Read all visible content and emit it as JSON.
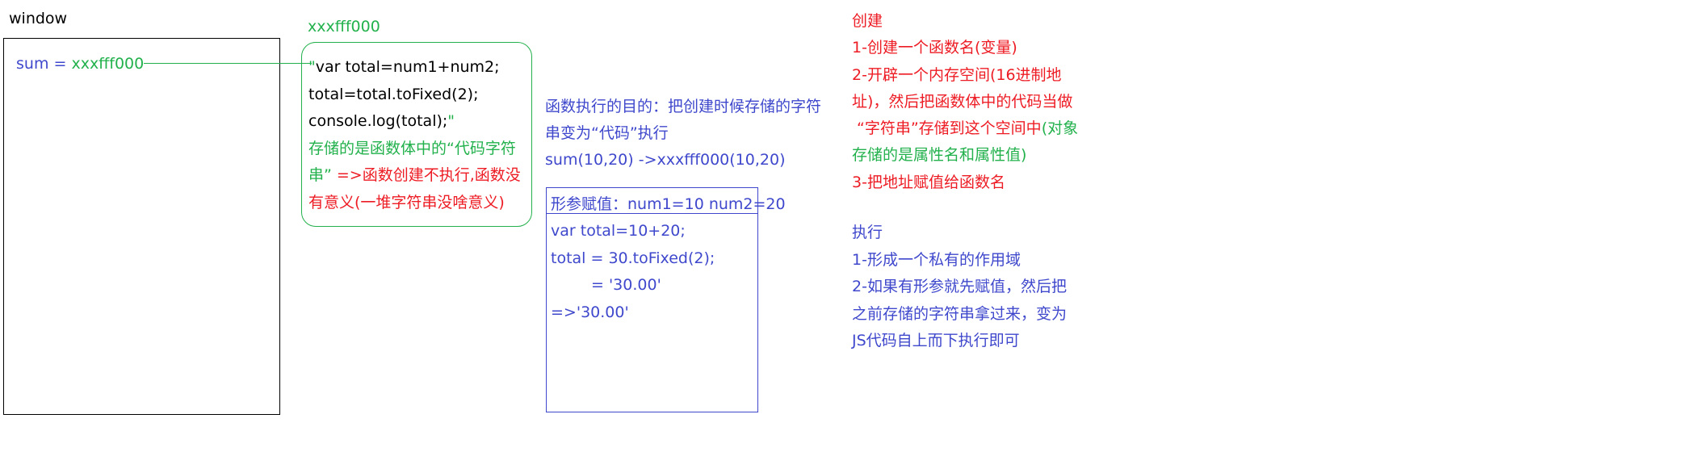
{
  "window": {
    "title": "window",
    "var_name": "sum",
    "equals": " = ",
    "address": "xxxfff000"
  },
  "heap": {
    "address": "xxxfff000",
    "code_line1_quote": "\"",
    "code_line1": "var total=num1+num2;",
    "code_line2": "total=total.toFixed(2);",
    "code_line3": "console.log(total);",
    "code_line3_quote": "\"",
    "note_line1": "存储的是函数体中的“代码字符",
    "note_line2_green": "串” ",
    "note_line2_red": "=>函数创建不执行,函数没",
    "note_line3": "有意义(一堆字符串没啥意义)"
  },
  "purpose": {
    "line1": "函数执行的目的：把创建时候存储的字符",
    "line2": "串变为“代码”执行",
    "line3": "sum(10,20) ->xxxfff000(10,20)"
  },
  "call": {
    "params": "形参赋值：num1=10  num2=20",
    "line1": "var total=10+20;",
    "line2": "total  = 30.toFixed(2);",
    "line3": "= '30.00'",
    "line4": "=>'30.00'"
  },
  "create": {
    "title": "创建",
    "step1": "1-创建一个函数名(变量)",
    "step2_line1": "2-开辟一个内存空间(16进制地",
    "step2_line2": "址)，然后把函数体中的代码当做",
    "step2_line3_red": "“字符串”存储到这个空间中",
    "step2_line3_green": "(对象",
    "step2_line4": "存储的是属性名和属性值)",
    "step3": "3-把地址赋值给函数名"
  },
  "execute": {
    "title": "执行",
    "step1": "1-形成一个私有的作用域",
    "step2_line1": "2-如果有形参就先赋值，然后把",
    "step2_line2": "之前存储的字符串拿过来，变为",
    "step2_line3": "JS代码自上而下执行即可"
  },
  "colors": {
    "black": "#000000",
    "green": "#22b14c",
    "red": "#ed1c24",
    "blue": "#3f48cc"
  }
}
